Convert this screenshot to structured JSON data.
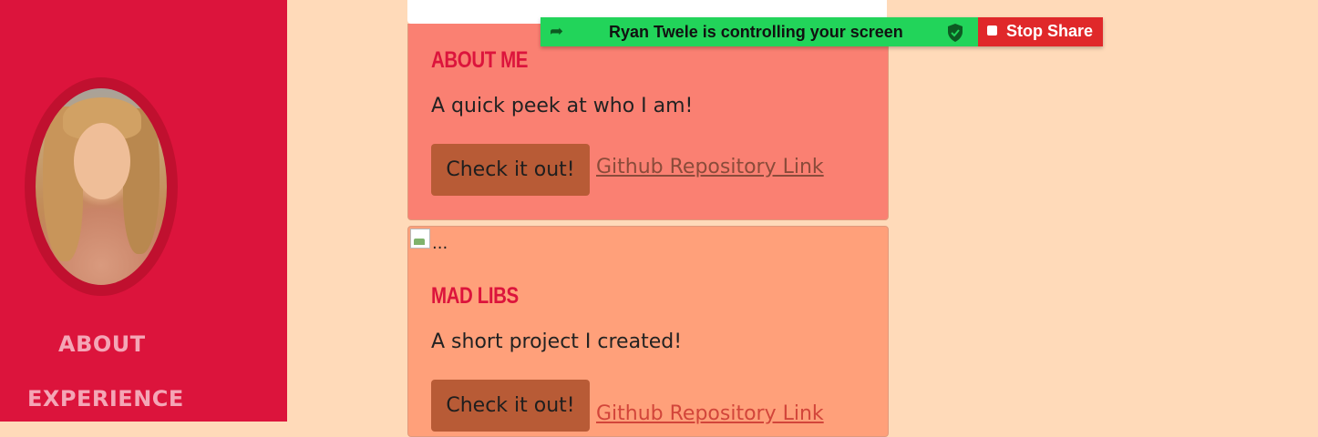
{
  "sidebar": {
    "nav": [
      {
        "label": "ABOUT"
      },
      {
        "label": "EXPERIENCE"
      }
    ]
  },
  "cards": [
    {
      "title": "ABOUT ME",
      "text": "A quick peek at who I am!",
      "button_label": "Check it out!",
      "link_label": "Github Repository Link"
    },
    {
      "image_alt": "...",
      "title": "MAD LIBS",
      "text": "A short project I created!",
      "button_label": "Check it out!",
      "link_label": "Github Repository Link"
    }
  ],
  "share_bar": {
    "message": "Ryan Twele is controlling your screen",
    "stop_label": "Stop Share"
  },
  "colors": {
    "sidebar": "#dc143c",
    "page_bg": "#ffdab9",
    "card_about_bg": "#fa8072",
    "card_mad_bg": "#ffa07a",
    "button_bg": "#b85b36",
    "share_green": "#22d45a",
    "share_red": "#e0282a"
  }
}
